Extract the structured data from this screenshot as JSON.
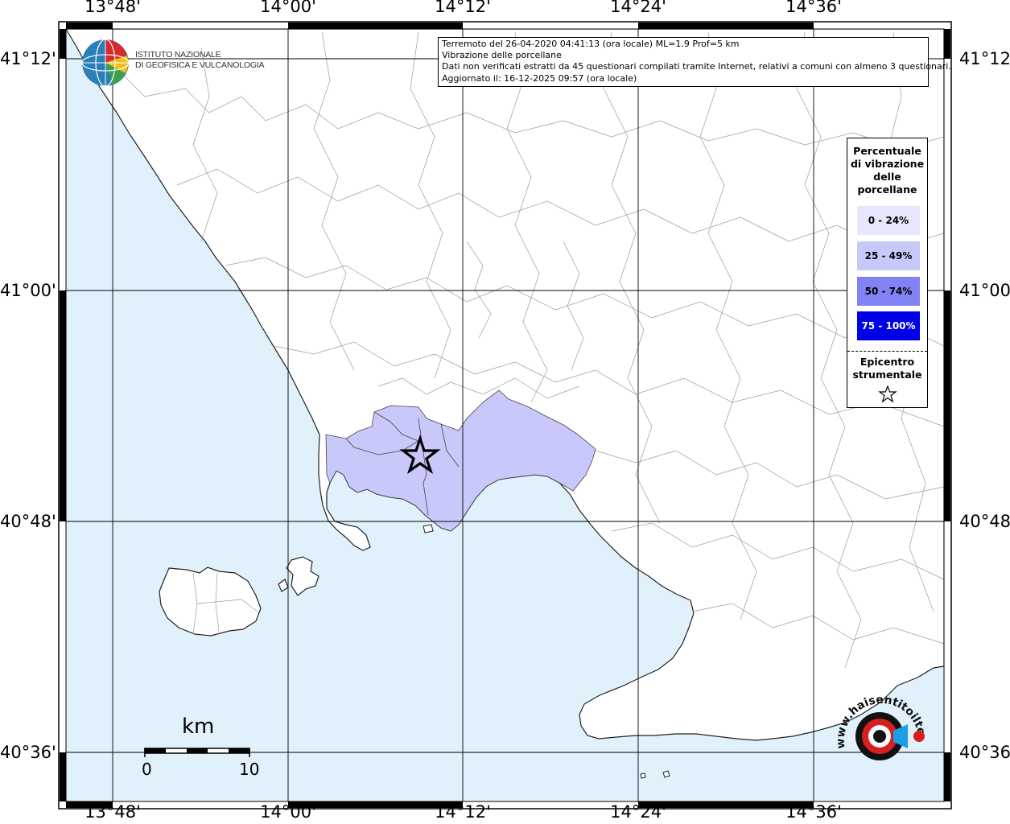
{
  "map": {
    "lon_labels": [
      "13°48'",
      "14°00'",
      "14°12'",
      "14°24'",
      "14°36'"
    ],
    "lat_labels": [
      "41°12'",
      "41°00'",
      "40°48'",
      "40°36'"
    ],
    "colors": {
      "sea": "#e1f1fc",
      "land": "#ffffff",
      "felt_25_49": "#c8c8fa",
      "boundaries": "#999999"
    }
  },
  "info": {
    "line1": "Terremoto del 26-04-2020 04:41:13 (ora locale) ML=1.9 Prof=5 km",
    "line2": "Vibrazione delle porcellane",
    "line3": "Dati non verificati estratti da 45 questionari compilati tramite Internet, relativi a comuni con almeno 3 questionari.",
    "line4": "Aggiornato il: 16-12-2025 09:57 (ora locale)"
  },
  "legend": {
    "title_lines": [
      "Percentuale",
      "di vibrazione",
      "delle",
      "porcellane"
    ],
    "items": [
      {
        "label": "0 - 24%",
        "color": "#e6e6fc",
        "text_color": "#000000"
      },
      {
        "label": "25 - 49%",
        "color": "#c8c8fa",
        "text_color": "#000000"
      },
      {
        "label": "50 - 74%",
        "color": "#8282f5",
        "text_color": "#000000"
      },
      {
        "label": "75 - 100%",
        "color": "#0000e6",
        "text_color": "#ffffff"
      }
    ],
    "epicenter_lines": [
      "Epicentro",
      "strumentale"
    ],
    "epicenter_icon": "star-icon"
  },
  "logo": {
    "ingv_line1": "ISTITUTO NAZIONALE",
    "ingv_line2": "DI GEOFISICA E VULCANOLOGIA"
  },
  "scale": {
    "unit": "km",
    "start": "0",
    "end": "10"
  },
  "watermark": "www.haisentitoilterremoto.it"
}
